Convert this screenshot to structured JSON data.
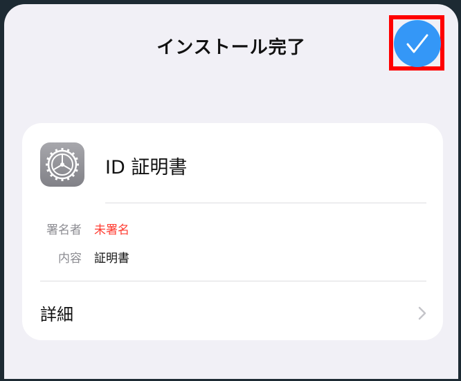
{
  "header": {
    "title": "インストール完了"
  },
  "done_button": {
    "icon": "checkmark-icon",
    "color": "#3497f7"
  },
  "profile": {
    "name": "ID 証明書",
    "icon": "settings-gear-icon",
    "fields": [
      {
        "label": "署名者",
        "value": "未署名",
        "value_color": "#ff3b30"
      },
      {
        "label": "内容",
        "value": "証明書",
        "value_color": "#111111"
      }
    ],
    "details_label": "詳細"
  },
  "highlight_color": "#ff0000"
}
